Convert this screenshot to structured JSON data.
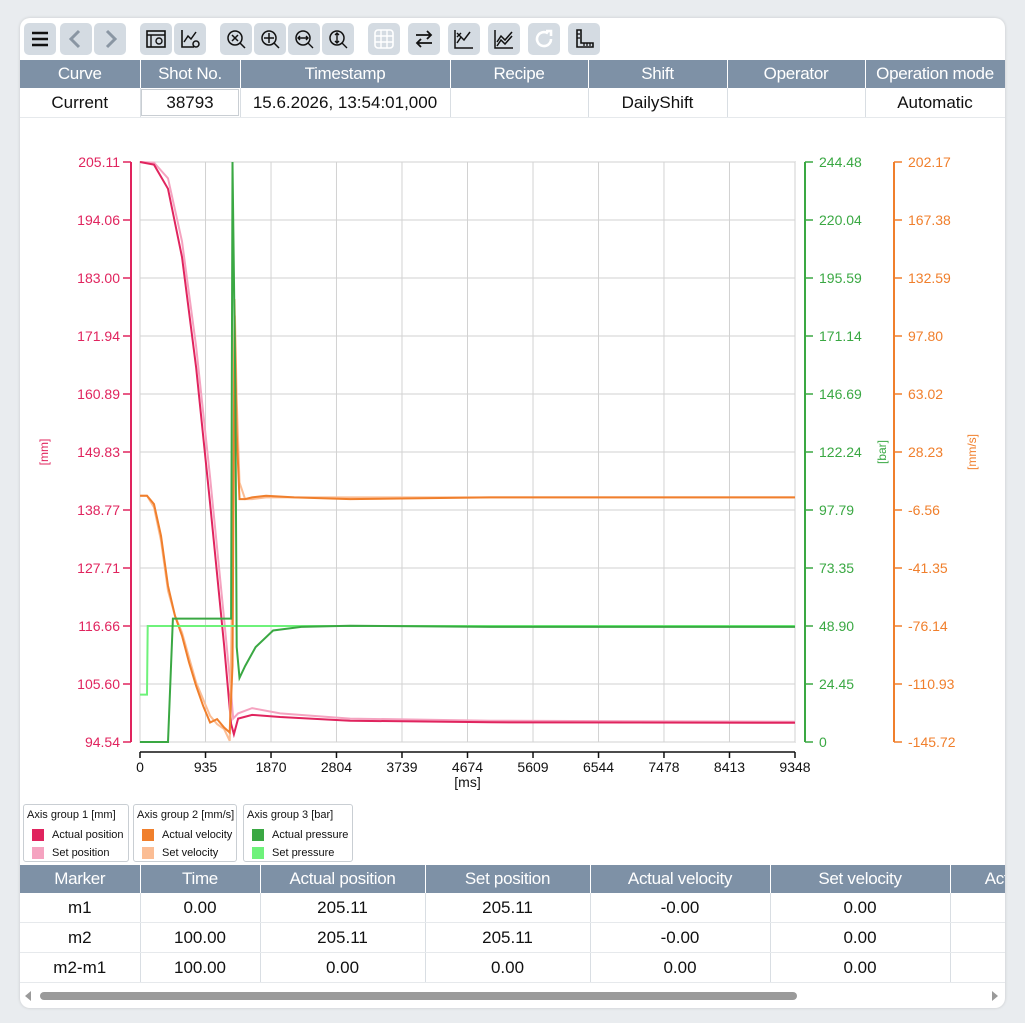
{
  "toolbar": {
    "buttons": [
      "menu-icon",
      "back-icon",
      "forward-icon",
      "table-view-icon",
      "chart-settings-icon",
      "zoom-reset-icon",
      "zoom-in-icon",
      "zoom-horizontal-icon",
      "zoom-vertical-icon",
      "grid-icon",
      "swap-icon",
      "curve-select-icon",
      "curves-icon",
      "refresh-icon",
      "ruler-icon"
    ]
  },
  "info_table": {
    "headers": [
      "Curve",
      "Shot No.",
      "Timestamp",
      "Recipe",
      "Shift",
      "Operator",
      "Operation mode"
    ],
    "row": {
      "curve": "Current",
      "shot_no": "38793",
      "timestamp": "15.6.2026, 13:54:01,000",
      "recipe": "",
      "shift": "DailyShift",
      "operator": "",
      "operation_mode": "Automatic"
    }
  },
  "chart_data": {
    "type": "line",
    "xlabel": "[ms]",
    "xticks": [
      "0",
      "935",
      "1870",
      "2804",
      "3739",
      "4674",
      "5609",
      "6544",
      "7478",
      "8413",
      "9348"
    ],
    "xlim": [
      0,
      9348
    ],
    "grid": true,
    "axes": {
      "mm": {
        "label": "[mm]",
        "color": "#e0245e",
        "ticks": [
          "205.11",
          "194.06",
          "183.00",
          "171.94",
          "160.89",
          "149.83",
          "138.77",
          "127.71",
          "116.66",
          "105.60",
          "94.54"
        ],
        "ylim": [
          94.54,
          205.11
        ]
      },
      "bar": {
        "label": "[bar]",
        "color": "#3aa843",
        "ticks": [
          "244.48",
          "220.04",
          "195.59",
          "171.14",
          "146.69",
          "122.24",
          "97.79",
          "73.35",
          "48.90",
          "24.45",
          "0"
        ],
        "ylim": [
          0,
          244.48
        ]
      },
      "mms": {
        "label": "[mm/s]",
        "color": "#f07f2c",
        "ticks": [
          "202.17",
          "167.38",
          "132.59",
          "97.80",
          "63.02",
          "28.23",
          "-6.56",
          "-41.35",
          "-76.14",
          "-110.93",
          "-145.72"
        ],
        "ylim": [
          -145.72,
          202.17
        ]
      }
    },
    "series": [
      {
        "name": "Set position",
        "axis": "mm",
        "color": "#f5a3c0",
        "x": [
          0,
          200,
          400,
          600,
          800,
          1000,
          1200,
          1300,
          1330,
          1400,
          1600,
          2000,
          3000,
          5000,
          9348
        ],
        "y": [
          205.11,
          205,
          202,
          190,
          170,
          145,
          118,
          104,
          99,
          100,
          101,
          100,
          99,
          98.6,
          98.4
        ]
      },
      {
        "name": "Actual position",
        "axis": "mm",
        "color": "#e0245e",
        "x": [
          0,
          200,
          400,
          600,
          800,
          1000,
          1200,
          1300,
          1340,
          1400,
          1600,
          2000,
          3000,
          5000,
          9348
        ],
        "y": [
          205.11,
          204.6,
          200,
          187,
          166,
          140,
          113,
          98,
          96,
          99,
          99.7,
          99.3,
          98.6,
          98.3,
          98.2
        ]
      },
      {
        "name": "Set velocity",
        "axis": "mms",
        "color": "#fbbd94",
        "x": [
          0,
          100,
          200,
          300,
          400,
          500,
          600,
          700,
          800,
          900,
          1000,
          1100,
          1200,
          1280,
          1320,
          1350,
          1380,
          1420,
          1500,
          1600,
          1800,
          2200,
          3000,
          5000,
          9348
        ],
        "y": [
          2,
          2,
          -5,
          -25,
          -55,
          -70,
          -80,
          -95,
          -110,
          -120,
          -130,
          -135,
          -138,
          -145,
          -40,
          120,
          60,
          10,
          0,
          0,
          1,
          1,
          1,
          1,
          1
        ]
      },
      {
        "name": "Actual velocity",
        "axis": "mms",
        "color": "#f07f2c",
        "x": [
          0,
          100,
          200,
          300,
          400,
          500,
          600,
          700,
          800,
          900,
          1000,
          1100,
          1200,
          1280,
          1320,
          1350,
          1380,
          1420,
          1500,
          1600,
          1800,
          2200,
          3000,
          5000,
          9348
        ],
        "y": [
          2,
          2,
          -3,
          -22,
          -52,
          -70,
          -82,
          -98,
          -112,
          -124,
          -134,
          -132,
          -137,
          -140,
          -100,
          110,
          40,
          0,
          0,
          1,
          2,
          1,
          0,
          1,
          1
        ]
      },
      {
        "name": "Set pressure",
        "axis": "bar",
        "color": "#6ef27a",
        "x": [
          0,
          100,
          110,
          400,
          1350,
          1400,
          9348
        ],
        "y": [
          20,
          20,
          48.9,
          48.9,
          48.9,
          48.9,
          48.9
        ]
      },
      {
        "name": "Actual pressure",
        "axis": "bar",
        "color": "#3aa843",
        "x": [
          0,
          400,
          470,
          1300,
          1320,
          1360,
          1380,
          1420,
          1500,
          1650,
          1900,
          2300,
          3000,
          5000,
          9348
        ],
        "y": [
          0,
          0,
          52,
          52,
          244.48,
          150,
          40,
          27,
          32,
          40,
          47,
          48.5,
          49,
          48.5,
          48.5
        ]
      }
    ],
    "legend": [
      {
        "title": "Axis group 1 [mm]",
        "items": [
          {
            "label": "Actual position",
            "color": "#e0245e"
          },
          {
            "label": "Set position",
            "color": "#f5a3c0"
          }
        ]
      },
      {
        "title": "Axis group 2 [mm/s]",
        "items": [
          {
            "label": "Actual velocity",
            "color": "#f07f2c"
          },
          {
            "label": "Set velocity",
            "color": "#fbbd94"
          }
        ]
      },
      {
        "title": "Axis group 3 [bar]",
        "items": [
          {
            "label": "Actual pressure",
            "color": "#3aa843"
          },
          {
            "label": "Set pressure",
            "color": "#6ef27a"
          }
        ]
      }
    ]
  },
  "marker_table": {
    "headers": [
      "Marker",
      "Time",
      "Actual position",
      "Set position",
      "Actual velocity",
      "Set velocity",
      "Actual"
    ],
    "rows": [
      [
        "m1",
        "0.00",
        "205.11",
        "205.11",
        "-0.00",
        "0.00",
        ""
      ],
      [
        "m2",
        "100.00",
        "205.11",
        "205.11",
        "-0.00",
        "0.00",
        ""
      ],
      [
        "m2-m1",
        "100.00",
        "0.00",
        "0.00",
        "0.00",
        "0.00",
        ""
      ]
    ]
  }
}
